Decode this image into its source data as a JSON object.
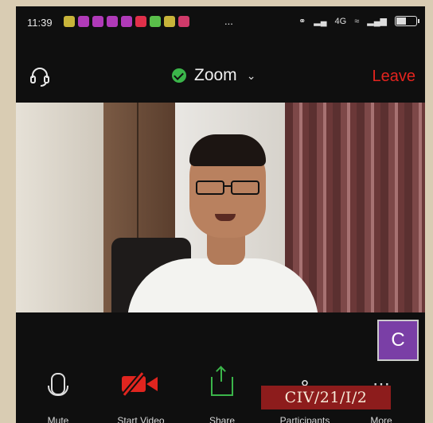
{
  "status_bar": {
    "time": "11:39",
    "overflow": "...",
    "network": "4G",
    "notification_colors": [
      "#c8b43a",
      "#b03ab8",
      "#b03ab8",
      "#b03ab8",
      "#b03ab8",
      "#e0304a",
      "#5abf4a",
      "#c8b43a",
      "#d03a6a"
    ],
    "battery_level": 0.55
  },
  "header": {
    "meeting_title": "Zoom",
    "leave_label": "Leave"
  },
  "participant_tile": {
    "initial": "C"
  },
  "toolbar": {
    "mute_label": "Mute",
    "start_video_label": "Start Video",
    "share_label": "Share",
    "participants_label": "Participants",
    "more_label": "More"
  },
  "overlay_stamp": "CIV/21/I/2",
  "colors": {
    "leave": "#e3241f",
    "secure": "#3bb54a",
    "video_off": "#e0251f",
    "share": "#3bb54a",
    "avatar_bg": "#7a3fa6",
    "stamp_bg": "#8d1c1c"
  }
}
